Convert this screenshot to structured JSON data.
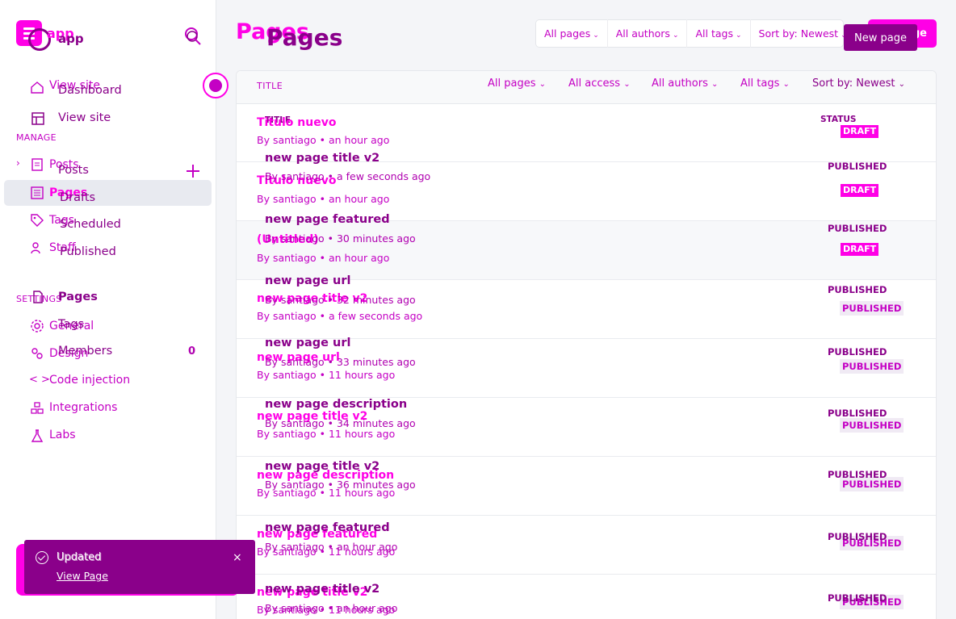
{
  "app": {
    "name_primary": "app",
    "name_secondary": "app"
  },
  "colors": {
    "accent": "#ff00e6",
    "accent_dark": "#8a008a",
    "text_accent": "#c400c4"
  },
  "nav_primary": {
    "view_site": "View site",
    "section_manage": "MANAGE",
    "posts": "Posts",
    "pages": "Pages",
    "tags": "Tags",
    "staff": "Staff",
    "section_settings": "SETTINGS",
    "general": "General",
    "design": "Design",
    "code_injection": "Code injection",
    "integrations": "Integrations",
    "labs": "Labs"
  },
  "nav_secondary": {
    "dashboard": "Dashboard",
    "view_site": "View site",
    "posts": "Posts",
    "drafts": "Drafts",
    "scheduled": "Scheduled",
    "published": "Published",
    "pages": "Pages",
    "tags": "Tags",
    "members": "Members",
    "members_count": "0"
  },
  "header": {
    "title_primary": "Pages",
    "title_secondary": "Pages",
    "filters": [
      "All pages",
      "All authors",
      "All tags",
      "Sort by: Newest"
    ],
    "new_page_primary": "New page",
    "new_page_secondary": "New page"
  },
  "table": {
    "col_title_primary": "TITLE",
    "filters": [
      "All pages",
      "All access",
      "All authors",
      "All tags",
      "Sort by: Newest"
    ],
    "sort_secondary": "Sort by: Newest",
    "col_title_secondary": "TITLE",
    "col_status_secondary": "STATUS",
    "rows_primary": [
      {
        "title": "Titulo nuevo",
        "meta": "By santiago • an hour ago",
        "status": "DRAFT"
      },
      {
        "title": "Titulo nuevo",
        "meta": "By santiago • an hour ago",
        "status": "DRAFT"
      },
      {
        "title": "(Untitled)",
        "meta": "By santiago • an hour ago",
        "status": "DRAFT"
      },
      {
        "title": "new page title v2",
        "meta": "By santiago • a few seconds ago",
        "status": "PUBLISHED"
      },
      {
        "title": "new page url",
        "meta": "By santiago • 11 hours ago",
        "status": "PUBLISHED"
      },
      {
        "title": "new page title v2",
        "meta": "By santiago • 11 hours ago",
        "status": "PUBLISHED"
      },
      {
        "title": "new page description",
        "meta": "By santiago • 11 hours ago",
        "status": "PUBLISHED"
      },
      {
        "title": "new page featured",
        "meta": "By santiago • 11 hours ago",
        "status": "PUBLISHED"
      },
      {
        "title": "new page title v2",
        "meta": "By santiago • 11 hours ago",
        "status": "PUBLISHED"
      }
    ],
    "rows_secondary": [
      {
        "title": "new page title v2",
        "meta": "By santiago • a few seconds ago",
        "status": "PUBLISHED"
      },
      {
        "title": "new page featured",
        "meta": "By santiago • 30 minutes ago",
        "status": "PUBLISHED"
      },
      {
        "title": "new page url",
        "meta": "By santiago • 32 minutes ago",
        "status": "PUBLISHED"
      },
      {
        "title": "new page url",
        "meta": "By santiago • 33 minutes ago",
        "status": "PUBLISHED"
      },
      {
        "title": "new page description",
        "meta": "By santiago • 34 minutes ago",
        "status": "PUBLISHED"
      },
      {
        "title": "new page title v2",
        "meta": "By santiago • 36 minutes ago",
        "status": "PUBLISHED"
      },
      {
        "title": "new page featured",
        "meta": "By santiago • an hour ago",
        "status": "PUBLISHED"
      },
      {
        "title": "new page title v2",
        "meta": "By santiago • an hour ago",
        "status": "PUBLISHED"
      }
    ]
  },
  "toast": {
    "title": "Updated",
    "title_secondary": "Updated",
    "link": "View Page"
  }
}
